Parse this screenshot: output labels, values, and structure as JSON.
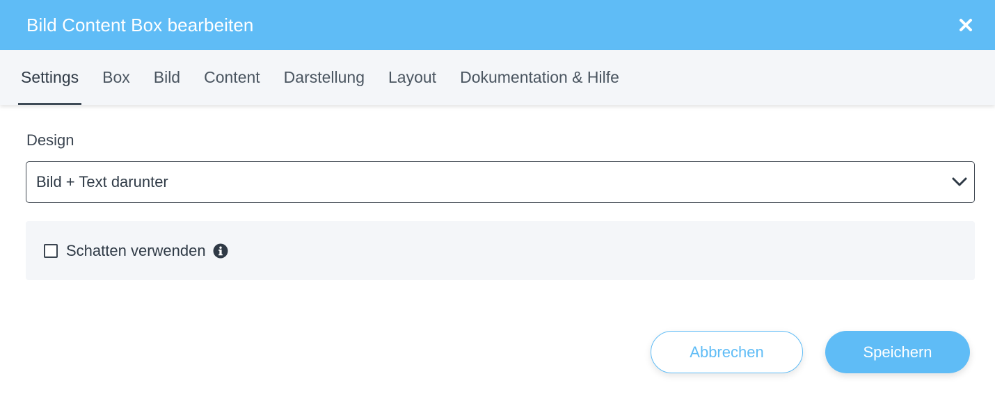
{
  "dialog": {
    "title": "Bild Content Box bearbeiten",
    "close_icon": "close-icon"
  },
  "tabs": [
    {
      "label": "Settings",
      "active": true
    },
    {
      "label": "Box",
      "active": false
    },
    {
      "label": "Bild",
      "active": false
    },
    {
      "label": "Content",
      "active": false
    },
    {
      "label": "Darstellung",
      "active": false
    },
    {
      "label": "Layout",
      "active": false
    },
    {
      "label": "Dokumentation & Hilfe",
      "active": false
    }
  ],
  "design": {
    "label": "Design",
    "selected_value": "Bild + Text darunter",
    "dropdown_icon": "chevron-down-icon"
  },
  "shadow_option": {
    "label": "Schatten verwenden",
    "checked": false,
    "info_icon": "info-icon"
  },
  "footer": {
    "cancel_label": "Abbrechen",
    "save_label": "Speichern"
  },
  "colors": {
    "accent": "#5fbcf6",
    "text": "#2f3a46",
    "panel_bg": "#f4f6f9"
  }
}
